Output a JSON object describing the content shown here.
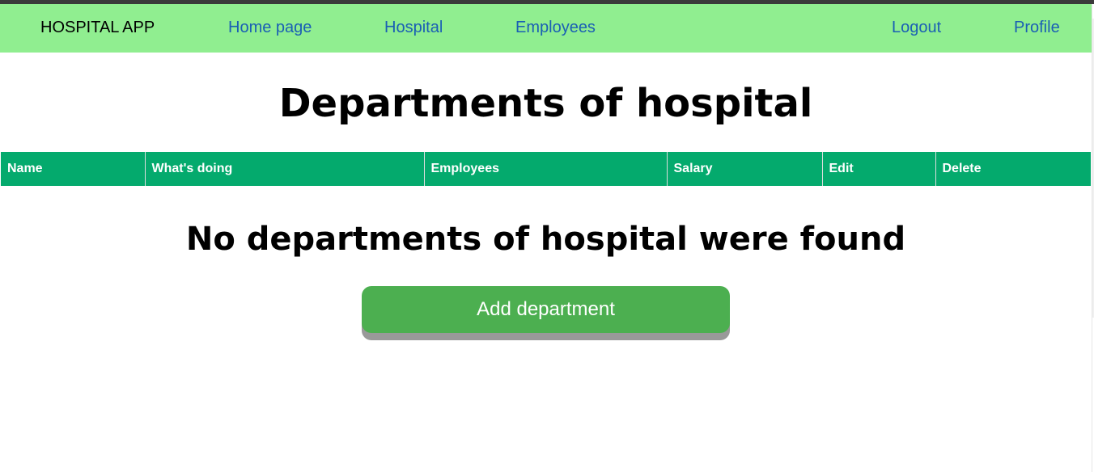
{
  "navbar": {
    "brand": "HOSPITAL APP",
    "links": [
      {
        "label": "Home page"
      },
      {
        "label": "Hospital"
      },
      {
        "label": "Employees"
      }
    ],
    "right_links": [
      {
        "label": "Logout"
      },
      {
        "label": "Profile"
      }
    ]
  },
  "main": {
    "title": "Departments of hospital",
    "table": {
      "columns": [
        "Name",
        "What's doing",
        "Employees",
        "Salary",
        "Edit",
        "Delete"
      ],
      "rows": []
    },
    "empty_message": "No departments of hospital were found",
    "add_button_label": "Add department"
  },
  "colors": {
    "navbar_bg": "#90ee90",
    "table_header_bg": "#04aa6d",
    "button_bg": "#4caf50",
    "link": "#1a5fb4"
  }
}
